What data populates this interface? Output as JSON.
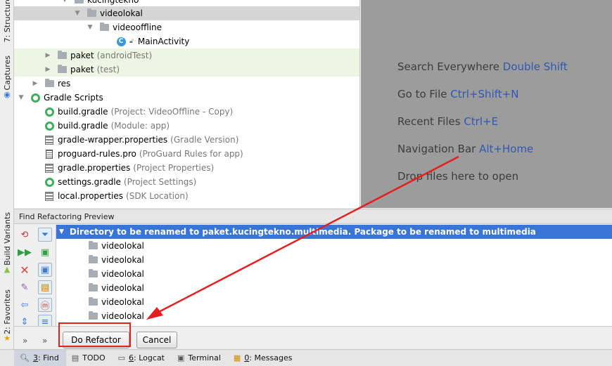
{
  "left_strip": {
    "structure_label": "7: Structure",
    "captures_label": "Captures",
    "build_variants_label": "Build Variants",
    "favorites_label": "2: Favorites"
  },
  "tree": {
    "rows": [
      {
        "label": "kucingtekno",
        "hint": ""
      },
      {
        "label": "videolokal",
        "hint": ""
      },
      {
        "label": "videooffline",
        "hint": ""
      },
      {
        "label": "MainActivity",
        "hint": ""
      },
      {
        "label": "paket",
        "hint": "(androidTest)"
      },
      {
        "label": "paket",
        "hint": "(test)"
      },
      {
        "label": "res",
        "hint": ""
      },
      {
        "label": "Gradle Scripts",
        "hint": ""
      },
      {
        "label": "build.gradle",
        "hint": "(Project: VideoOffline - Copy)"
      },
      {
        "label": "build.gradle",
        "hint": "(Module: app)"
      },
      {
        "label": "gradle-wrapper.properties",
        "hint": "(Gradle Version)"
      },
      {
        "label": "proguard-rules.pro",
        "hint": "(ProGuard Rules for app)"
      },
      {
        "label": "gradle.properties",
        "hint": "(Project Properties)"
      },
      {
        "label": "settings.gradle",
        "hint": "(Project Settings)"
      },
      {
        "label": "local.properties",
        "hint": "(SDK Location)"
      }
    ]
  },
  "editor_tips": [
    {
      "text": "Search Everywhere",
      "shortcut": "Double Shift"
    },
    {
      "text": "Go to File",
      "shortcut": "Ctrl+Shift+N"
    },
    {
      "text": "Recent Files",
      "shortcut": "Ctrl+E"
    },
    {
      "text": "Navigation Bar",
      "shortcut": "Alt+Home"
    },
    {
      "text": "Drop files here to open",
      "shortcut": ""
    }
  ],
  "find_panel": {
    "title": "Find Refactoring Preview",
    "header": "Directory to be renamed to paket.kucingtekno.multimedia. Package to be renamed to multimedia",
    "results": [
      "videolokal",
      "videolokal",
      "videolokal",
      "videolokal",
      "videolokal",
      "videolokal"
    ],
    "more": "»",
    "do_refactor_label": "Do Refactor",
    "cancel_label": "Cancel"
  },
  "bottom_tabs": [
    {
      "num": "3",
      "label": ": Find",
      "icon": "search-icon"
    },
    {
      "num": "",
      "label": "TODO",
      "icon": "todo-icon"
    },
    {
      "num": "6",
      "label": ": Logcat",
      "icon": "logcat-icon"
    },
    {
      "num": "",
      "label": "Terminal",
      "icon": "terminal-icon"
    },
    {
      "num": "0",
      "label": ": Messages",
      "icon": "messages-icon"
    }
  ],
  "colors": {
    "selection": "#3875d7",
    "annotation_red": "#e51f1f",
    "shortcut_blue": "#2f58b4"
  }
}
